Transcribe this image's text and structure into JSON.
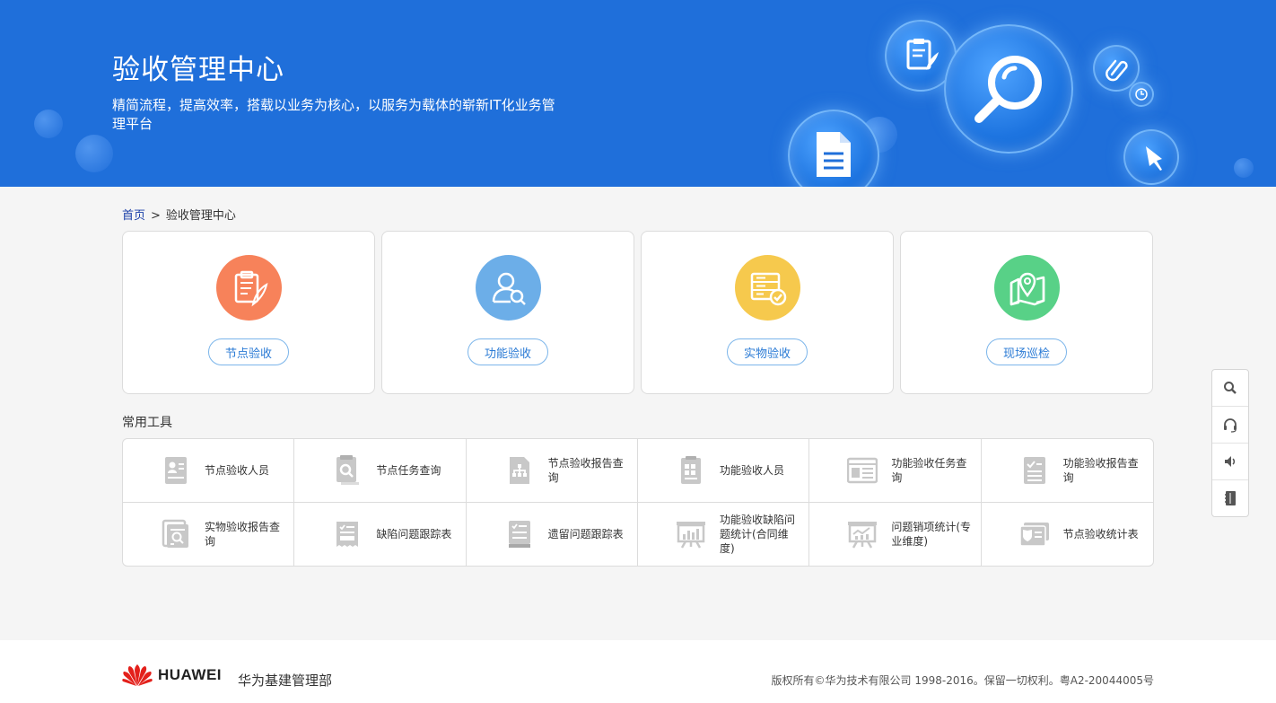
{
  "banner": {
    "title": "验收管理中心",
    "subtitle": "精简流程，提高效率，搭载以业务为核心，以服务为载体的崭新IT化业务管理平台"
  },
  "breadcrumb": {
    "home": "首页",
    "separator": ">",
    "current": "验收管理中心"
  },
  "cards": [
    {
      "label": "节点验收",
      "icon": "clipboard-pen-icon",
      "color": "#f7825a"
    },
    {
      "label": "功能验收",
      "icon": "user-search-icon",
      "color": "#6caee8"
    },
    {
      "label": "实物验收",
      "icon": "server-check-icon",
      "color": "#f6c94d"
    },
    {
      "label": "现场巡检",
      "icon": "map-pin-icon",
      "color": "#58d187"
    }
  ],
  "tools_title": "常用工具",
  "tools": [
    {
      "label": "节点验收人员",
      "icon": "id-card-icon"
    },
    {
      "label": "节点任务查询",
      "icon": "doc-search-icon"
    },
    {
      "label": "节点验收报告查询",
      "icon": "org-report-icon"
    },
    {
      "label": "功能验收人员",
      "icon": "grid-doc-icon"
    },
    {
      "label": "功能验收任务查询",
      "icon": "browser-list-icon"
    },
    {
      "label": "功能验收报告查询",
      "icon": "check-list-icon"
    },
    {
      "label": "实物验收报告查询",
      "icon": "stack-search-icon"
    },
    {
      "label": "缺陷问题跟踪表",
      "icon": "ticket-list-icon"
    },
    {
      "label": "遗留问题跟踪表",
      "icon": "book-list-icon"
    },
    {
      "label": "功能验收缺陷问题统计(合同维度)",
      "icon": "board-chart-icon"
    },
    {
      "label": "问题销项统计(专业维度)",
      "icon": "board-trend-icon"
    },
    {
      "label": "节点验收统计表",
      "icon": "shield-card-icon"
    }
  ],
  "float_bar": [
    "search-icon",
    "headset-icon",
    "speaker-icon",
    "notebook-icon"
  ],
  "footer": {
    "logo_text": "HUAWEI",
    "department": "华为基建管理部",
    "copyright": "版权所有©华为技术有限公司 1998-2016。保留一切权利。粤A2-20044005号"
  },
  "colors": {
    "banner": "#1f6fda",
    "button_text": "#2b7bd5",
    "logo_red": "#e3201b"
  }
}
